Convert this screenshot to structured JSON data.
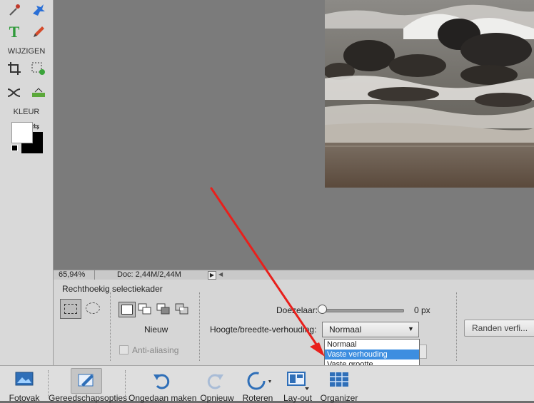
{
  "toolbox": {
    "section_modify": "WIJZIGEN",
    "section_color": "KLEUR"
  },
  "status": {
    "zoom": "65,94%",
    "doc": "Doc: 2,44M/2,44M"
  },
  "options": {
    "tool_name": "Rechthoekig selectiekader",
    "mode_label": "Nieuw",
    "antialias_label": "Anti-aliasing",
    "feather_label": "Doezelaar:",
    "feather_value": "0 px",
    "feather_level": 0,
    "aspect_label": "Hoogte/breedte-verhouding:",
    "aspect_selected": "Normaal",
    "aspect_options": [
      "Normaal",
      "Vaste verhouding",
      "Vaste grootte"
    ],
    "aspect_highlighted": "Vaste verhouding",
    "refine_button": "Randen verfi..."
  },
  "bottombar": {
    "photo_bin": "Fotovak",
    "tool_options": "Gereedschapsopties",
    "undo": "Ongedaan maken",
    "redo": "Opnieuw",
    "rotate": "Roteren",
    "layout": "Lay-out",
    "organizer": "Organizer"
  },
  "colors": {
    "annotation_arrow": "#e8201c",
    "highlight": "#3d8ee0",
    "foreground": "#ffffff",
    "background": "#000000"
  }
}
